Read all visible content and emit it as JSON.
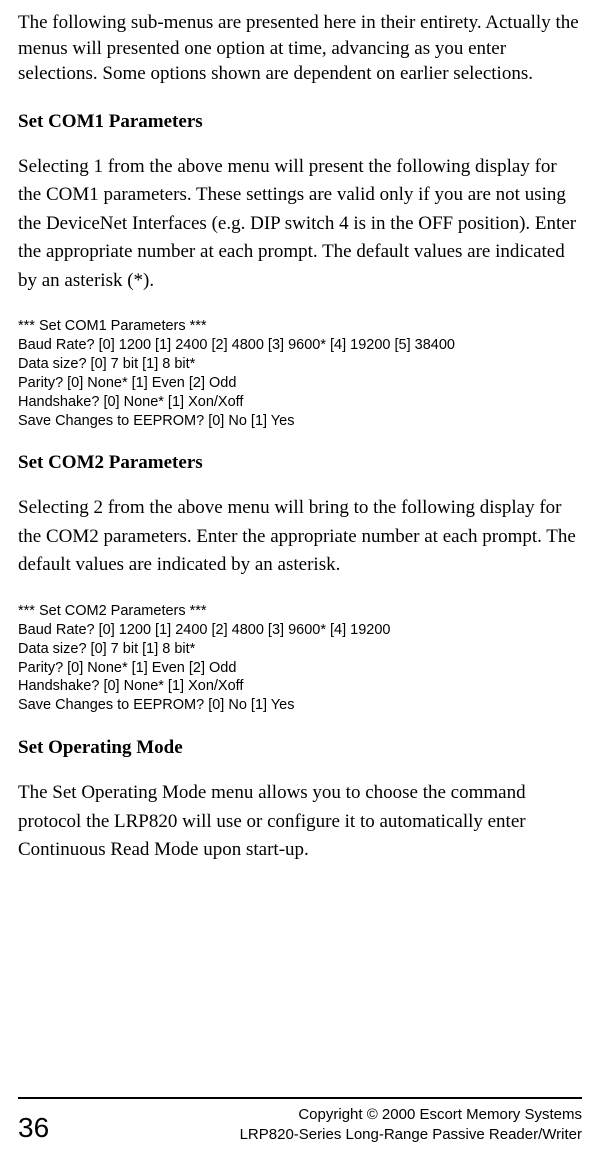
{
  "intro": "The following sub-menus are presented here in their entirety. Actually the menus will presented one option at time, advancing as you enter selections. Some options shown are dependent on earlier selections.",
  "sections": {
    "com1": {
      "heading": "Set COM1 Parameters",
      "paragraph": "Selecting 1 from the above menu will present the following display for the COM1 parameters. These settings are valid only if you are not using the DeviceNet Interfaces (e.g. DIP switch 4 is in the OFF position). Enter the appropriate number at each prompt. The default values are indicated by an asterisk (*).",
      "terminal": "*** Set COM1 Parameters ***\nBaud Rate? [0] 1200 [1] 2400 [2] 4800 [3] 9600* [4] 19200 [5] 38400\nData size? [0] 7 bit [1] 8 bit*\nParity? [0] None* [1] Even [2] Odd\nHandshake? [0] None* [1] Xon/Xoff\nSave Changes to EEPROM? [0] No [1] Yes"
    },
    "com2": {
      "heading": "Set COM2 Parameters",
      "paragraph": "Selecting 2 from the above menu will bring to the following display for the COM2 parameters. Enter the appropriate number at each prompt. The default values are indicated by an asterisk.",
      "terminal": "*** Set COM2 Parameters ***\nBaud Rate? [0] 1200 [1] 2400 [2] 4800 [3] 9600* [4] 19200\nData size? [0] 7 bit [1] 8 bit*\nParity? [0] None* [1] Even [2] Odd\nHandshake? [0] None* [1] Xon/Xoff\nSave Changes to EEPROM? [0] No [1] Yes"
    },
    "opmode": {
      "heading": "Set Operating Mode",
      "paragraph": "The Set Operating Mode menu allows you to choose the command protocol the LRP820 will use or configure it to automatically enter Continuous Read Mode upon start-up."
    }
  },
  "footer": {
    "page_number": "36",
    "copyright": "Copyright © 2000 Escort Memory Systems",
    "product": "LRP820-Series Long-Range Passive Reader/Writer"
  }
}
